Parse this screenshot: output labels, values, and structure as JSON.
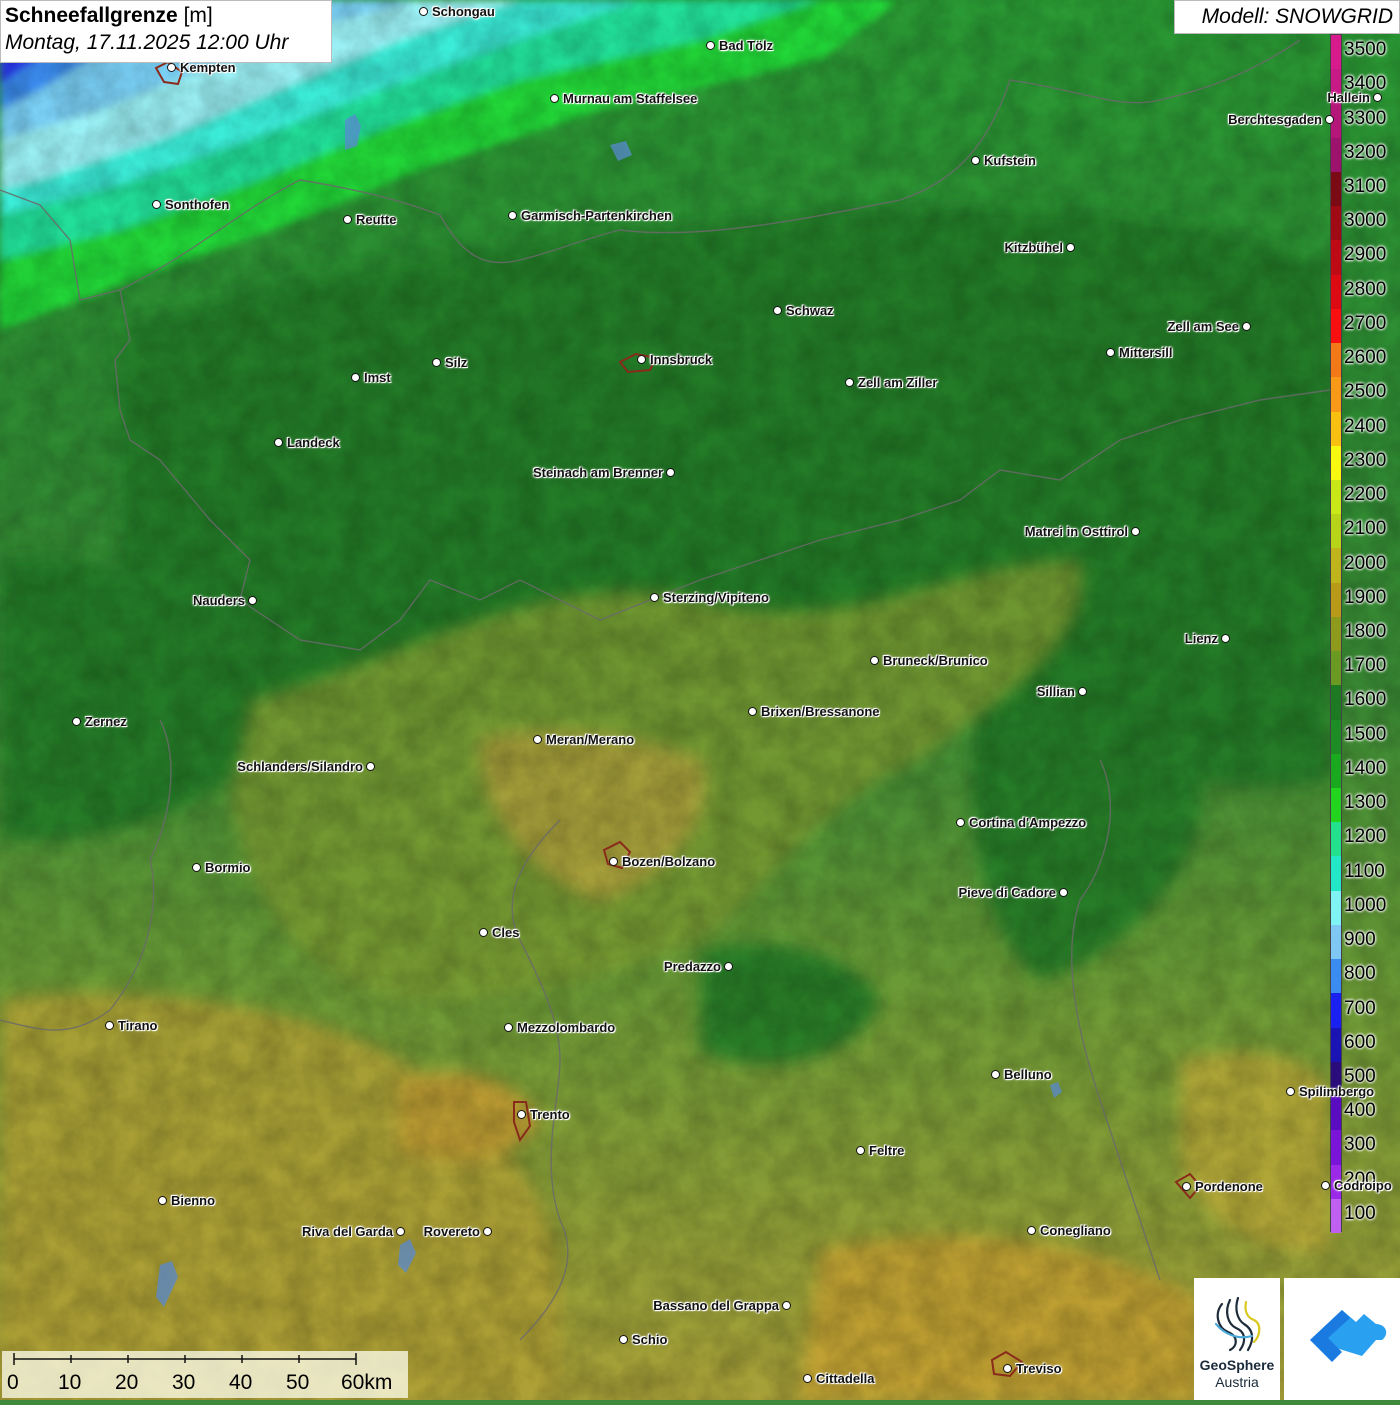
{
  "header": {
    "title": "Schneefallgrenze",
    "unit": "[m]",
    "datetime": "Montag, 17.11.2025 12:00 Uhr",
    "model": "Modell: SNOWGRID"
  },
  "legend": {
    "levels": [
      {
        "label": "3500",
        "color": "#d81b8c"
      },
      {
        "label": "3400",
        "color": "#c81a86"
      },
      {
        "label": "3300",
        "color": "#b4167a"
      },
      {
        "label": "3200",
        "color": "#9c126c"
      },
      {
        "label": "3100",
        "color": "#7a0a14"
      },
      {
        "label": "3000",
        "color": "#a00a14"
      },
      {
        "label": "2900",
        "color": "#be0a14"
      },
      {
        "label": "2800",
        "color": "#dc0a12"
      },
      {
        "label": "2700",
        "color": "#f81010"
      },
      {
        "label": "2600",
        "color": "#f27818"
      },
      {
        "label": "2500",
        "color": "#f89a18"
      },
      {
        "label": "2400",
        "color": "#f8c010"
      },
      {
        "label": "2300",
        "color": "#f8f810"
      },
      {
        "label": "2200",
        "color": "#c8e818"
      },
      {
        "label": "2100",
        "color": "#b8d418"
      },
      {
        "label": "2000",
        "color": "#c0b41c"
      },
      {
        "label": "1900",
        "color": "#b89a18"
      },
      {
        "label": "1800",
        "color": "#8e9a1c"
      },
      {
        "label": "1700",
        "color": "#6a9a22"
      },
      {
        "label": "1600",
        "color": "#1e7a22"
      },
      {
        "label": "1500",
        "color": "#1e8c24"
      },
      {
        "label": "1400",
        "color": "#1aa81e"
      },
      {
        "label": "1300",
        "color": "#22d41e"
      },
      {
        "label": "1200",
        "color": "#22e08c"
      },
      {
        "label": "1100",
        "color": "#22e8c8"
      },
      {
        "label": "1000",
        "color": "#80f4f4"
      },
      {
        "label": "900",
        "color": "#80c8f4"
      },
      {
        "label": "800",
        "color": "#3a8cf0"
      },
      {
        "label": "700",
        "color": "#1a20f0"
      },
      {
        "label": "600",
        "color": "#1a14b4"
      },
      {
        "label": "500",
        "color": "#2a0c7a"
      },
      {
        "label": "400",
        "color": "#5a0cc0"
      },
      {
        "label": "300",
        "color": "#7a14d8"
      },
      {
        "label": "200",
        "color": "#9c28e8"
      },
      {
        "label": "100",
        "color": "#c060f0"
      }
    ]
  },
  "cities": [
    {
      "name": "Schongau"
    },
    {
      "name": "Bad Tölz"
    },
    {
      "name": "Kempten"
    },
    {
      "name": "Murnau am Staffelsee"
    },
    {
      "name": "Hallein"
    },
    {
      "name": "Berchtesgaden"
    },
    {
      "name": "Kufstein"
    },
    {
      "name": "Sonthofen"
    },
    {
      "name": "Reutte"
    },
    {
      "name": "Garmisch-Partenkirchen"
    },
    {
      "name": "Kitzbühel"
    },
    {
      "name": "Schwaz"
    },
    {
      "name": "Zell am See"
    },
    {
      "name": "Innsbruck"
    },
    {
      "name": "Mittersill"
    },
    {
      "name": "Silz"
    },
    {
      "name": "Imst"
    },
    {
      "name": "Zell am Ziller"
    },
    {
      "name": "Landeck"
    },
    {
      "name": "Steinach am Brenner"
    },
    {
      "name": "Matrei in Osttirol"
    },
    {
      "name": "Nauders"
    },
    {
      "name": "Sterzing/Vipiteno"
    },
    {
      "name": "Lienz"
    },
    {
      "name": "Bruneck/Brunico"
    },
    {
      "name": "Sillian"
    },
    {
      "name": "Zernez"
    },
    {
      "name": "Brixen/Bressanone"
    },
    {
      "name": "Meran/Merano"
    },
    {
      "name": "Schlanders/Silandro"
    },
    {
      "name": "Cortina d'Ampezzo"
    },
    {
      "name": "Bozen/Bolzano"
    },
    {
      "name": "Bormio"
    },
    {
      "name": "Pieve di Cadore"
    },
    {
      "name": "Cles"
    },
    {
      "name": "Predazzo"
    },
    {
      "name": "Tirano"
    },
    {
      "name": "Mezzolombardo"
    },
    {
      "name": "Belluno"
    },
    {
      "name": "Spilimbergo"
    },
    {
      "name": "Trento"
    },
    {
      "name": "Feltre"
    },
    {
      "name": "Pordenone"
    },
    {
      "name": "Codroipo"
    },
    {
      "name": "Bienno"
    },
    {
      "name": "Riva del Garda"
    },
    {
      "name": "Rovereto"
    },
    {
      "name": "Conegliano"
    },
    {
      "name": "Bassano del Grappa"
    },
    {
      "name": "Schio"
    },
    {
      "name": "Treviso"
    },
    {
      "name": "Cittadella"
    }
  ],
  "scale": {
    "labels": [
      "0",
      "10",
      "20",
      "30",
      "40",
      "50",
      "60km"
    ]
  },
  "logos": {
    "geosphere_line1": "GeoSphere",
    "geosphere_line2": "Austria"
  },
  "colors": {
    "map_green_dark": "#2f7a30",
    "map_green": "#3f9a38",
    "map_olive": "#86a83a",
    "map_ochre": "#b0a038",
    "map_cyan": "#36e6c8",
    "map_blue": "#2a3cf0"
  }
}
